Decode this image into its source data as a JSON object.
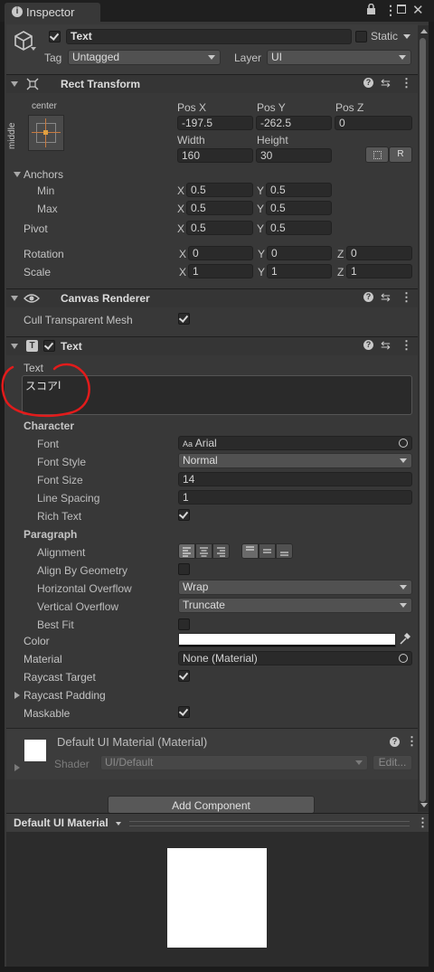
{
  "tab": {
    "title": "Inspector"
  },
  "gameobject": {
    "name": "Text",
    "static_label": "Static",
    "tag_label": "Tag",
    "tag_value": "Untagged",
    "layer_label": "Layer",
    "layer_value": "UI"
  },
  "rect_transform": {
    "title": "Rect Transform",
    "anchor_preset_top": "center",
    "anchor_preset_side": "middle",
    "posx_label": "Pos X",
    "posx": "-197.5",
    "posy_label": "Pos Y",
    "posy": "-262.5",
    "posz_label": "Pos Z",
    "posz": "0",
    "width_label": "Width",
    "width": "160",
    "height_label": "Height",
    "height": "30",
    "r_button": "R",
    "anchors_label": "Anchors",
    "min_label": "Min",
    "min_x": "0.5",
    "min_y": "0.5",
    "max_label": "Max",
    "max_x": "0.5",
    "max_y": "0.5",
    "pivot_label": "Pivot",
    "pivot_x": "0.5",
    "pivot_y": "0.5",
    "rotation_label": "Rotation",
    "rot_x": "0",
    "rot_y": "0",
    "rot_z": "0",
    "scale_label": "Scale",
    "scale_x": "1",
    "scale_y": "1",
    "scale_z": "1",
    "x": "X",
    "y": "Y",
    "z": "Z"
  },
  "canvas_renderer": {
    "title": "Canvas Renderer",
    "cull_label": "Cull Transparent Mesh",
    "cull_checked": true
  },
  "text_component": {
    "title": "Text",
    "text_label": "Text",
    "text_value": "スコア",
    "character_label": "Character",
    "font_label": "Font",
    "font_prefix": "Aa",
    "font_value": "Arial",
    "font_style_label": "Font Style",
    "font_style_value": "Normal",
    "font_size_label": "Font Size",
    "font_size_value": "14",
    "line_spacing_label": "Line Spacing",
    "line_spacing_value": "1",
    "rich_text_label": "Rich Text",
    "rich_text_checked": true,
    "paragraph_label": "Paragraph",
    "alignment_label": "Alignment",
    "align_by_geometry_label": "Align By Geometry",
    "align_by_geometry_checked": false,
    "h_overflow_label": "Horizontal Overflow",
    "h_overflow_value": "Wrap",
    "v_overflow_label": "Vertical Overflow",
    "v_overflow_value": "Truncate",
    "best_fit_label": "Best Fit",
    "best_fit_checked": false,
    "color_label": "Color",
    "color_value": "#ffffff",
    "material_label": "Material",
    "material_value": "None (Material)",
    "raycast_target_label": "Raycast Target",
    "raycast_target_checked": true,
    "raycast_padding_label": "Raycast Padding",
    "maskable_label": "Maskable",
    "maskable_checked": true
  },
  "material_block": {
    "title": "Default UI Material (Material)",
    "shader_label": "Shader",
    "shader_value": "UI/Default",
    "edit_button": "Edit..."
  },
  "add_component": {
    "label": "Add Component"
  },
  "preview": {
    "title": "Default UI Material"
  },
  "colors": {
    "panel": "#383838",
    "header": "#353535",
    "accent": "#4a8adf",
    "annotation": "#e21b1b"
  }
}
